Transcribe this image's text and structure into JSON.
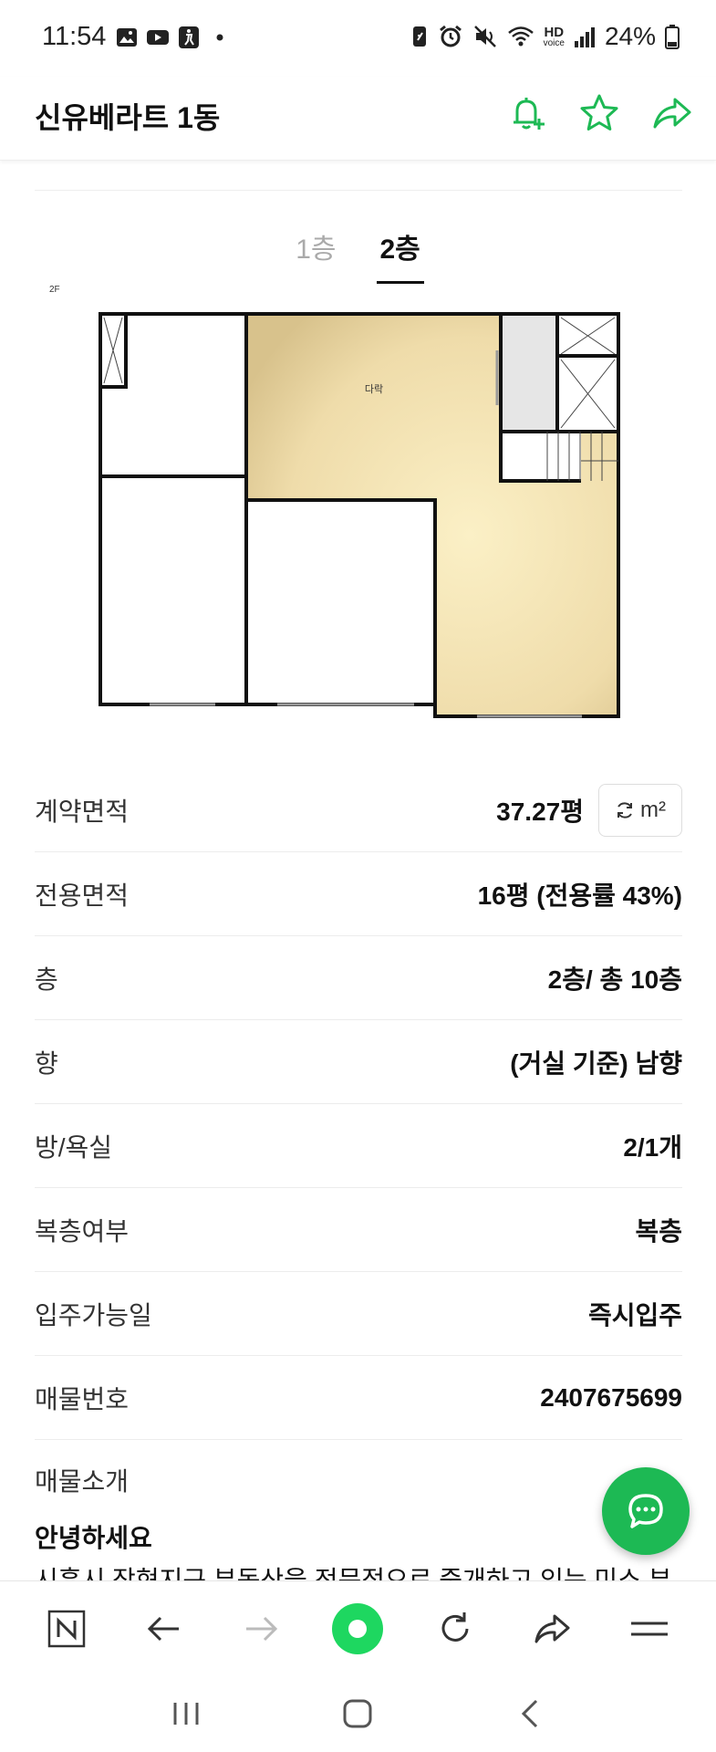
{
  "status_bar": {
    "time": "11:54",
    "battery_text": "24%",
    "hd_label": "HD",
    "voice_label": "voice",
    "icons": [
      "gallery-icon",
      "youtube-icon",
      "accessibility-icon",
      "dot-icon",
      "battery-saver-icon",
      "alarm-icon",
      "mute-icon",
      "wifi-icon",
      "signal-icon",
      "battery-icon"
    ]
  },
  "header": {
    "title": "신유베라트 1동",
    "actions": [
      "notification-add-icon",
      "star-icon",
      "share-icon"
    ],
    "accent_color": "#1db954"
  },
  "floor_tabs": {
    "items": [
      {
        "label": "1층",
        "active": false
      },
      {
        "label": "2층",
        "active": true
      }
    ]
  },
  "floorplan": {
    "floor_label": "2F",
    "room_label": "다락",
    "fill_color": "#efdcaa"
  },
  "details": {
    "rows": [
      {
        "label": "계약면적",
        "value": "37.27평"
      },
      {
        "label": "전용면적",
        "value": "16평 (전용률 43%)"
      },
      {
        "label": "층",
        "value": "2층/ 총 10층"
      },
      {
        "label": "향",
        "value": "(거실 기준) 남향"
      },
      {
        "label": "방/욕실",
        "value": "2/1개"
      },
      {
        "label": "복층여부",
        "value": "복층"
      },
      {
        "label": "입주가능일",
        "value": "즉시입주"
      },
      {
        "label": "매물번호",
        "value": "2407675699"
      }
    ],
    "unit_toggle_label": "m²"
  },
  "intro": {
    "label": "매물소개",
    "heading": "안녕하세요",
    "text": "시흥시 장현지구 부동산을 전문적으로 중개하고 있는 미소 부"
  },
  "browser_bar": {
    "buttons": [
      "naver-home-icon",
      "back-arrow-icon",
      "forward-arrow-icon",
      "green-dot-icon",
      "refresh-icon",
      "share-icon",
      "menu-icon"
    ]
  },
  "nav_bar": {
    "buttons": [
      "recent-apps-icon",
      "home-icon",
      "back-icon"
    ]
  }
}
